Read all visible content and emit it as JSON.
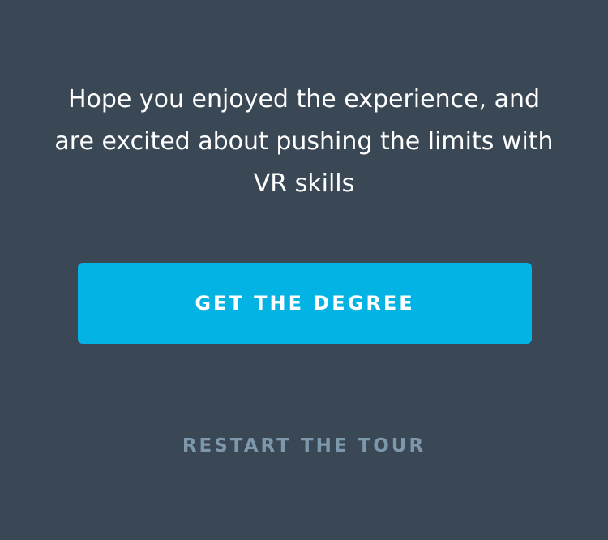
{
  "completion": {
    "message": "Hope you enjoyed the experience, and are excited about pushing the limits with VR skills",
    "primary_button_label": "GET THE DEGREE",
    "secondary_link_label": "RESTART THE TOUR"
  },
  "colors": {
    "background": "#3a4754",
    "primary_button": "#02b3e4",
    "secondary_link": "#7d97ad",
    "text": "#ffffff"
  }
}
